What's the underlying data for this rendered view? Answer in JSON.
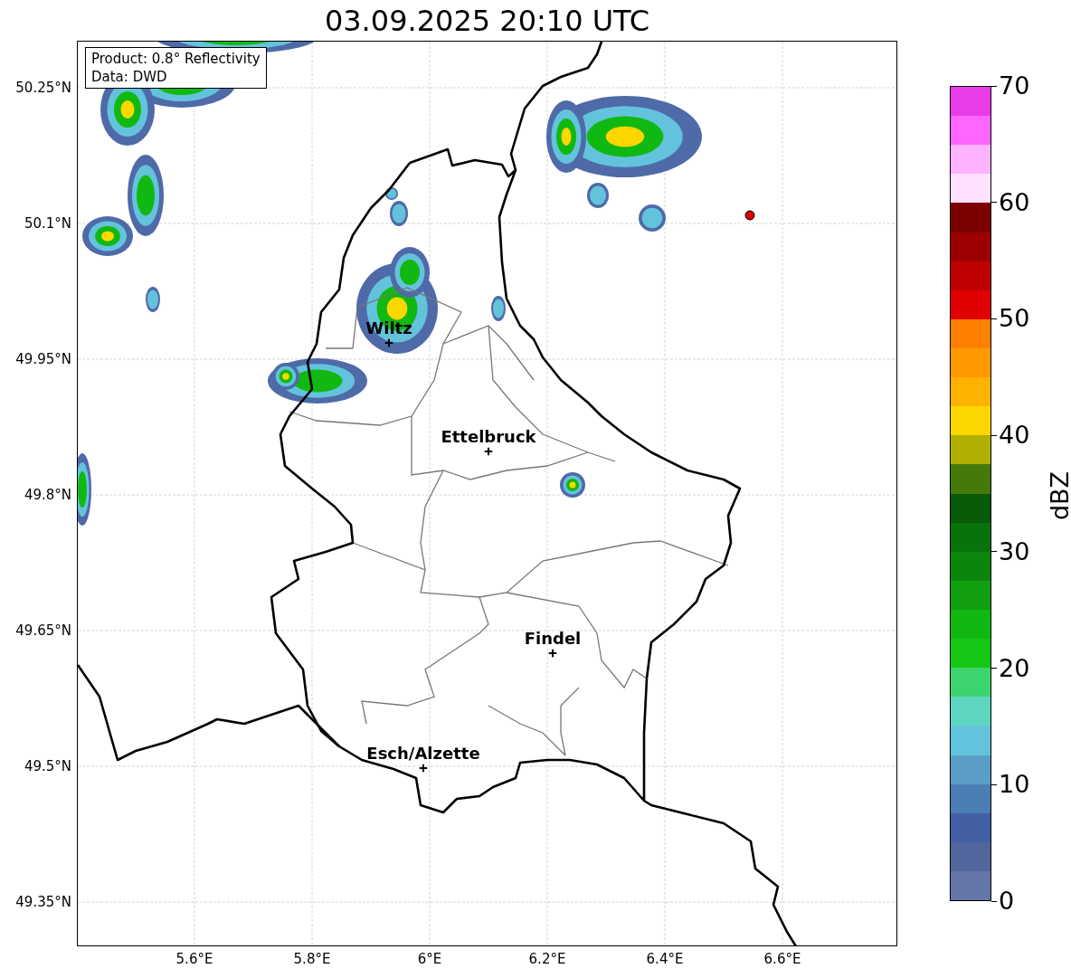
{
  "title": "03.09.2025 20:10 UTC",
  "info_box": [
    "Product: 0.8° Reflectivity",
    "Data: DWD"
  ],
  "lat_ticks": [
    "50.25°N",
    "50.1°N",
    "49.95°N",
    "49.8°N",
    "49.65°N",
    "49.5°N",
    "49.35°N"
  ],
  "lon_ticks": [
    "5.6°E",
    "5.8°E",
    "6°E",
    "6.2°E",
    "6.4°E",
    "6.6°E"
  ],
  "cities": [
    {
      "name": "Wiltz"
    },
    {
      "name": "Ettelbruck"
    },
    {
      "name": "Findel"
    },
    {
      "name": "Esch/Alzette"
    }
  ],
  "colorbar": {
    "label": "dBZ",
    "ticks": [
      "70",
      "60",
      "50",
      "40",
      "30",
      "20",
      "10",
      "0"
    ],
    "segments": [
      {
        "color": "#e83ce8"
      },
      {
        "color": "#ff66ff"
      },
      {
        "color": "#ffb3ff"
      },
      {
        "color": "#ffe0ff"
      },
      {
        "color": "#7b0000"
      },
      {
        "color": "#9c0000"
      },
      {
        "color": "#bf0000"
      },
      {
        "color": "#e00000"
      },
      {
        "color": "#ff7f00"
      },
      {
        "color": "#ff9900"
      },
      {
        "color": "#ffb300"
      },
      {
        "color": "#ffd700"
      },
      {
        "color": "#b0b000"
      },
      {
        "color": "#457a0a"
      },
      {
        "color": "#075a07"
      },
      {
        "color": "#0a720a"
      },
      {
        "color": "#0c850c"
      },
      {
        "color": "#10a010"
      },
      {
        "color": "#12b812"
      },
      {
        "color": "#14c814"
      },
      {
        "color": "#3dd46e"
      },
      {
        "color": "#5dd6c0"
      },
      {
        "color": "#64c3dc"
      },
      {
        "color": "#5a9ec8"
      },
      {
        "color": "#4a7eb4"
      },
      {
        "color": "#4460a4"
      },
      {
        "color": "#51669d"
      },
      {
        "color": "#6475a8"
      }
    ]
  }
}
